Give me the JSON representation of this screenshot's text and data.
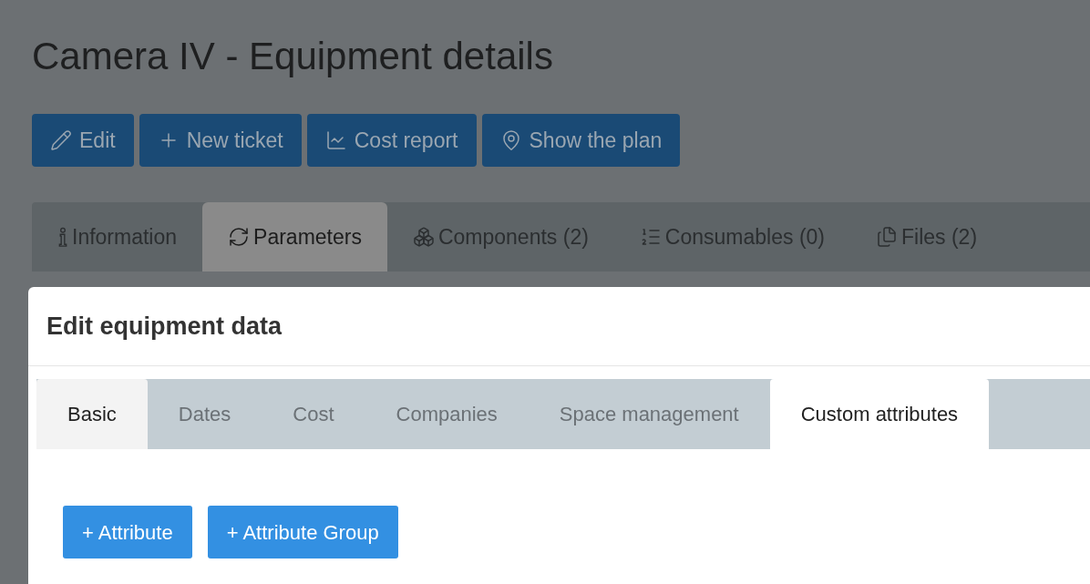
{
  "page": {
    "title": "Camera IV - Equipment details",
    "actions": [
      {
        "label": "Edit"
      },
      {
        "label": "New ticket"
      },
      {
        "label": "Cost report"
      },
      {
        "label": "Show the plan"
      }
    ],
    "tabs": [
      {
        "label": "Information",
        "selected": false
      },
      {
        "label": "Parameters",
        "selected": true
      },
      {
        "label": "Components (2)",
        "selected": false
      },
      {
        "label": "Consumables (0)",
        "selected": false
      },
      {
        "label": "Files (2)",
        "selected": false
      }
    ]
  },
  "dialog": {
    "title": "Edit equipment data",
    "tabs": [
      {
        "label": "Basic",
        "selected": false,
        "hovered": true
      },
      {
        "label": "Dates",
        "selected": false,
        "hovered": false
      },
      {
        "label": "Cost",
        "selected": false,
        "hovered": false
      },
      {
        "label": "Companies",
        "selected": false,
        "hovered": false
      },
      {
        "label": "Space management",
        "selected": false,
        "hovered": false
      },
      {
        "label": "Custom attributes",
        "selected": true,
        "hovered": false
      }
    ],
    "buttons": [
      "+ Attribute",
      "+ Attribute Group"
    ]
  }
}
